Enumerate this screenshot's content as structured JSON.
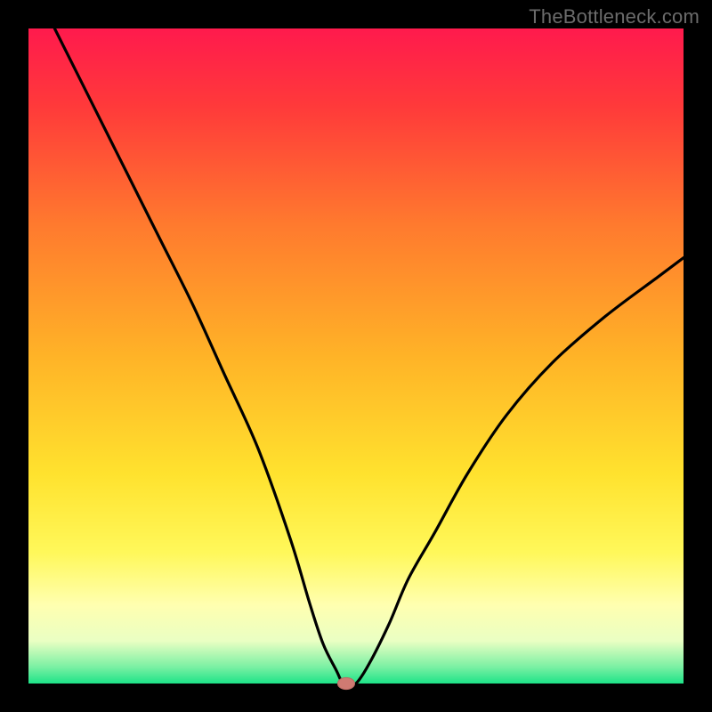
{
  "watermark": "TheBottleneck.com",
  "colors": {
    "frame": "#000000",
    "curve": "#000000",
    "marker_fill": "#cf7a72",
    "marker_stroke": "#b96b63",
    "gradient_stops": [
      {
        "offset": 0.0,
        "color": "#ff1a4d"
      },
      {
        "offset": 0.12,
        "color": "#ff3a3a"
      },
      {
        "offset": 0.3,
        "color": "#ff7a2e"
      },
      {
        "offset": 0.5,
        "color": "#ffb327"
      },
      {
        "offset": 0.68,
        "color": "#ffe22e"
      },
      {
        "offset": 0.8,
        "color": "#fff85a"
      },
      {
        "offset": 0.88,
        "color": "#ffffb0"
      },
      {
        "offset": 0.935,
        "color": "#eaffc3"
      },
      {
        "offset": 0.975,
        "color": "#7af0a3"
      },
      {
        "offset": 1.0,
        "color": "#1ee388"
      }
    ]
  },
  "chart_data": {
    "type": "line",
    "title": "",
    "xlabel": "",
    "ylabel": "",
    "xlim": [
      0,
      100
    ],
    "ylim": [
      0,
      100
    ],
    "legend": false,
    "grid": false,
    "series": [
      {
        "name": "bottleneck-curve",
        "x": [
          4,
          10,
          15,
          20,
          25,
          30,
          35,
          40,
          43,
          45,
          47,
          48,
          49,
          50,
          52,
          55,
          58,
          62,
          67,
          73,
          80,
          88,
          96,
          100
        ],
        "y": [
          100,
          88,
          78,
          68,
          58,
          47,
          36,
          22,
          12,
          6,
          2,
          0,
          0,
          0,
          3,
          9,
          16,
          23,
          32,
          41,
          49,
          56,
          62,
          65
        ]
      }
    ],
    "marker": {
      "x": 48.5,
      "y": 0,
      "rx": 1.3,
      "ry": 0.9
    }
  }
}
